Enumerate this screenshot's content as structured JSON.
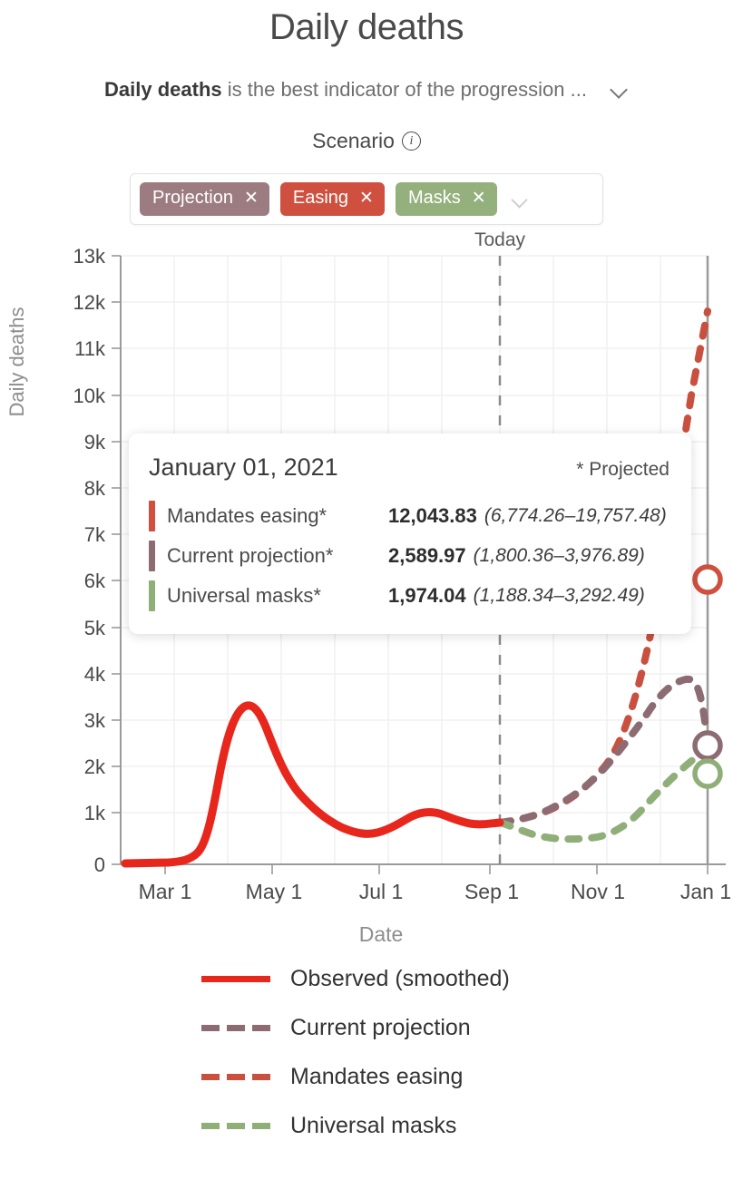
{
  "header": {
    "title": "Daily deaths",
    "subtitle_bold": "Daily deaths",
    "subtitle_rest": " is the best indicator of the progression ...",
    "expand_icon": "chevron-down-icon"
  },
  "scenario": {
    "label": "Scenario",
    "info_icon": "info-icon",
    "chips": [
      {
        "label": "Projection",
        "close": "✕",
        "color": "#9c7c80"
      },
      {
        "label": "Easing",
        "close": "✕",
        "color": "#d0503f"
      },
      {
        "label": "Masks",
        "close": "✕",
        "color": "#94b07c"
      }
    ],
    "dropdown_icon": "chevron-down-icon"
  },
  "chart_controls": {
    "settings_icon": "sliders-icon"
  },
  "tooltip": {
    "date": "January 01, 2021",
    "projected_note": "* Projected",
    "rows": [
      {
        "name": "Mandates easing*",
        "value": "12,043.83",
        "ci": "(6,774.26–19,757.48)",
        "color": "#d0503f"
      },
      {
        "name": "Current projection*",
        "value": "2,589.97",
        "ci": "(1,800.36–3,976.89)",
        "color": "#8d6b73"
      },
      {
        "name": "Universal masks*",
        "value": "1,974.04",
        "ci": "(1,188.34–3,292.49)",
        "color": "#8fae78"
      }
    ]
  },
  "legend": {
    "items": [
      {
        "label": "Observed (smoothed)",
        "color": "#e8271c",
        "style": "solid"
      },
      {
        "label": "Current projection",
        "color": "#8d6b73",
        "style": "dashed"
      },
      {
        "label": "Mandates easing",
        "color": "#c9503f",
        "style": "dashed"
      },
      {
        "label": "Universal masks",
        "color": "#8fae78",
        "style": "dashed"
      }
    ]
  },
  "chart_data": {
    "type": "line",
    "title": "Daily deaths",
    "xlabel": "Date",
    "ylabel": "Daily deaths",
    "grid": true,
    "legend_position": "bottom",
    "ylim": [
      0,
      13000
    ],
    "ytick_labels": [
      "0",
      "1k",
      "2k",
      "3k",
      "4k",
      "5k",
      "6k",
      "7k",
      "8k",
      "9k",
      "10k",
      "11k",
      "12k",
      "13k"
    ],
    "ytick_values": [
      0,
      1000,
      2000,
      3000,
      4000,
      5000,
      6000,
      7000,
      8000,
      9000,
      10000,
      11000,
      12000,
      13000
    ],
    "xtick_labels": [
      "Mar 1",
      "May 1",
      "Jul 1",
      "Sep 1",
      "Nov 1",
      "Jan 1"
    ],
    "xlim": [
      "2020-02-01",
      "2021-01-01"
    ],
    "annotations": [
      {
        "label": "Today",
        "x": "2020-09-01",
        "type": "vertical-dashed-line"
      }
    ],
    "series": [
      {
        "name": "Observed (smoothed)",
        "color": "#e8271c",
        "style": "solid",
        "x": [
          "Feb 1",
          "Feb 15",
          "Mar 1",
          "Mar 15",
          "Mar 25",
          "Apr 1",
          "Apr 10",
          "Apr 17",
          "May 1",
          "May 15",
          "Jun 1",
          "Jun 15",
          "Jul 1",
          "Jul 10",
          "Jul 20",
          "Aug 1",
          "Aug 10",
          "Aug 20",
          "Sep 1"
        ],
        "values": [
          30,
          35,
          40,
          120,
          800,
          1700,
          2250,
          2350,
          2000,
          1500,
          1150,
          800,
          640,
          640,
          800,
          1000,
          1100,
          1050,
          900
        ]
      },
      {
        "name": "Current projection",
        "color": "#8d6b73",
        "style": "dashed",
        "x": [
          "Sep 1",
          "Sep 15",
          "Oct 1",
          "Oct 15",
          "Nov 1",
          "Nov 15",
          "Dec 1",
          "Dec 10",
          "Dec 20",
          "Jan 1"
        ],
        "values": [
          900,
          950,
          1100,
          1350,
          1650,
          2150,
          2700,
          2900,
          2880,
          2589.97
        ],
        "ci_at_jan1": [
          1800.36,
          3976.89
        ]
      },
      {
        "name": "Mandates easing",
        "color": "#c9503f",
        "style": "dashed",
        "x": [
          "Sep 1",
          "Sep 15",
          "Oct 1",
          "Oct 15",
          "Nov 1",
          "Nov 15",
          "Dec 1",
          "Dec 10",
          "Dec 20",
          "Jan 1"
        ],
        "values": [
          900,
          960,
          1120,
          1400,
          1800,
          2900,
          5200,
          7600,
          9700,
          12043.83
        ],
        "ci_at_jan1": [
          6774.26,
          19757.48
        ]
      },
      {
        "name": "Universal masks",
        "color": "#8fae78",
        "style": "dashed",
        "x": [
          "Sep 1",
          "Sep 15",
          "Oct 1",
          "Oct 15",
          "Nov 1",
          "Nov 15",
          "Dec 1",
          "Dec 10",
          "Dec 20",
          "Jan 1"
        ],
        "values": [
          900,
          780,
          650,
          600,
          620,
          780,
          1100,
          1400,
          1700,
          1974.04
        ],
        "ci_at_jan1": [
          1188.34,
          3292.49
        ]
      }
    ],
    "endpoint_markers": [
      {
        "series": "Mandates easing",
        "value": 12043.83,
        "color": "#d0503f"
      },
      {
        "series": "Current projection",
        "value": 2589.97,
        "color": "#8d6b73"
      },
      {
        "series": "Universal masks",
        "value": 1974.04,
        "color": "#8fae78"
      }
    ]
  }
}
